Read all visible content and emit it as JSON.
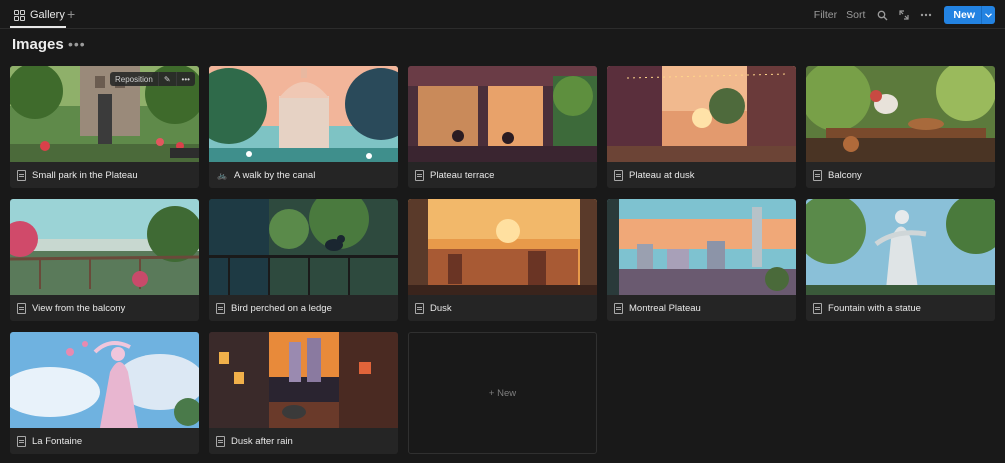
{
  "view_tab": {
    "label": "Gallery",
    "icon": "gallery-grid-icon"
  },
  "add_view": {
    "glyph": "+"
  },
  "toolbar": {
    "filter_label": "Filter",
    "sort_label": "Sort",
    "new_label": "New",
    "icons": [
      "search-icon",
      "expand-icon",
      "more-icon",
      "chevron-down-icon"
    ]
  },
  "page": {
    "title": "Images",
    "more": "•••"
  },
  "hover_controls": {
    "reposition": "Reposition",
    "edit_glyph": "✎",
    "more_glyph": "•••"
  },
  "cards": [
    {
      "title": "Small park in the Plateau",
      "icon": "page-icon"
    },
    {
      "title": "A walk by the canal",
      "icon": "bicycle-icon"
    },
    {
      "title": "Plateau terrace",
      "icon": "page-icon"
    },
    {
      "title": "Plateau at dusk",
      "icon": "page-icon"
    },
    {
      "title": "Balcony",
      "icon": "page-icon"
    },
    {
      "title": "View from the balcony",
      "icon": "page-icon"
    },
    {
      "title": "Bird perched on a ledge",
      "icon": "page-icon"
    },
    {
      "title": "Dusk",
      "icon": "page-icon"
    },
    {
      "title": "Montreal Plateau",
      "icon": "page-icon"
    },
    {
      "title": "Fountain with a statue",
      "icon": "page-icon"
    },
    {
      "title": "La Fontaine",
      "icon": "page-icon"
    },
    {
      "title": "Dusk after rain",
      "icon": "page-icon"
    }
  ],
  "new_card": {
    "label": "+ New"
  },
  "colors": {
    "background": "#191919",
    "card": "#252525",
    "accent": "#2383e2"
  }
}
